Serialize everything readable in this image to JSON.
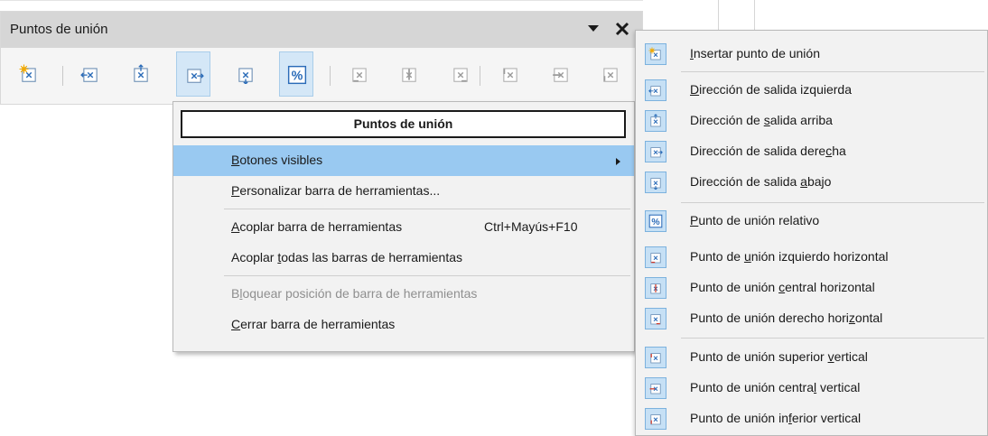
{
  "toolbar": {
    "title": "Puntos de unión",
    "buttons": [
      {
        "name": "insert-glue-point",
        "icon": "insert-glue-point-icon",
        "active": false,
        "enabled": true
      },
      {
        "name": "exit-left",
        "icon": "exit-left-icon",
        "active": false,
        "enabled": true
      },
      {
        "name": "exit-top",
        "icon": "exit-top-icon",
        "active": false,
        "enabled": true
      },
      {
        "name": "exit-right",
        "icon": "exit-right-icon",
        "active": true,
        "enabled": true
      },
      {
        "name": "exit-bottom",
        "icon": "exit-bottom-icon",
        "active": false,
        "enabled": true
      },
      {
        "name": "relative",
        "icon": "percent-icon",
        "active": true,
        "enabled": true
      },
      {
        "name": "horizontal-left",
        "icon": "horizontal-left-icon",
        "active": false,
        "enabled": false
      },
      {
        "name": "horizontal-center",
        "icon": "horizontal-center-icon",
        "active": false,
        "enabled": false
      },
      {
        "name": "horizontal-right",
        "icon": "horizontal-right-icon",
        "active": false,
        "enabled": false
      },
      {
        "name": "vertical-top",
        "icon": "vertical-top-icon",
        "active": false,
        "enabled": false
      },
      {
        "name": "vertical-center",
        "icon": "vertical-center-icon",
        "active": false,
        "enabled": false
      },
      {
        "name": "vertical-bottom",
        "icon": "vertical-bottom-icon",
        "active": false,
        "enabled": false
      }
    ]
  },
  "context_menu": {
    "header": "Puntos de unión",
    "items": [
      {
        "pre": "",
        "key": "B",
        "post": "otones visibles",
        "shortcut": "",
        "submenu": true,
        "highlighted": true,
        "disabled": false
      },
      {
        "pre": "",
        "key": "P",
        "post": "ersonalizar barra de herramientas...",
        "shortcut": "",
        "submenu": false,
        "highlighted": false,
        "disabled": false
      },
      {
        "pre": "",
        "key": "A",
        "post": "coplar barra de herramientas",
        "shortcut": "Ctrl+Mayús+F10",
        "submenu": false,
        "highlighted": false,
        "disabled": false
      },
      {
        "pre": "Acoplar ",
        "key": "t",
        "post": "odas las barras de herramientas",
        "shortcut": "",
        "submenu": false,
        "highlighted": false,
        "disabled": false
      },
      {
        "pre": "B",
        "key": "l",
        "post": "oquear posición de barra de herramientas",
        "shortcut": "",
        "submenu": false,
        "highlighted": false,
        "disabled": true
      },
      {
        "pre": "",
        "key": "C",
        "post": "errar barra de herramientas",
        "shortcut": "",
        "submenu": false,
        "highlighted": false,
        "disabled": false
      }
    ]
  },
  "submenu": {
    "items": [
      {
        "pre": "",
        "key": "I",
        "post": "nsertar punto de unión",
        "icon": "insert-glue-point-icon",
        "checked": true
      },
      {
        "pre": "",
        "key": "D",
        "post": "irección de salida izquierda",
        "icon": "exit-left-icon",
        "checked": true
      },
      {
        "pre": "Dirección de ",
        "key": "s",
        "post": "alida arriba",
        "icon": "exit-top-icon",
        "checked": true
      },
      {
        "pre": "Dirección de salida dere",
        "key": "c",
        "post": "ha",
        "icon": "exit-right-icon",
        "checked": true
      },
      {
        "pre": "Dirección de salida ",
        "key": "a",
        "post": "bajo",
        "icon": "exit-bottom-icon",
        "checked": true
      },
      {
        "pre": "",
        "key": "P",
        "post": "unto de unión relativo",
        "icon": "percent-icon",
        "checked": true
      },
      {
        "pre": "Punto de ",
        "key": "u",
        "post": "nión izquierdo horizontal",
        "icon": "horizontal-left-icon",
        "checked": true
      },
      {
        "pre": "Punto de unión ",
        "key": "c",
        "post": "entral horizontal",
        "icon": "horizontal-center-icon",
        "checked": true
      },
      {
        "pre": "Punto de unión derecho hori",
        "key": "z",
        "post": "ontal",
        "icon": "horizontal-right-icon",
        "checked": true
      },
      {
        "pre": "Punto de unión superior ",
        "key": "v",
        "post": "ertical",
        "icon": "vertical-top-icon",
        "checked": true
      },
      {
        "pre": "Punto de unión centra",
        "key": "l",
        "post": " vertical",
        "icon": "vertical-center-icon",
        "checked": true
      },
      {
        "pre": "Punto de unión in",
        "key": "f",
        "post": "erior vertical",
        "icon": "vertical-bottom-icon",
        "checked": true
      }
    ]
  },
  "colors": {
    "accent_blue": "#2a6bb8",
    "accent_red": "#d03a2a",
    "star_orange": "#f2a900",
    "disabled_gray": "#9a9a9a",
    "highlight": "#99c9f1"
  }
}
